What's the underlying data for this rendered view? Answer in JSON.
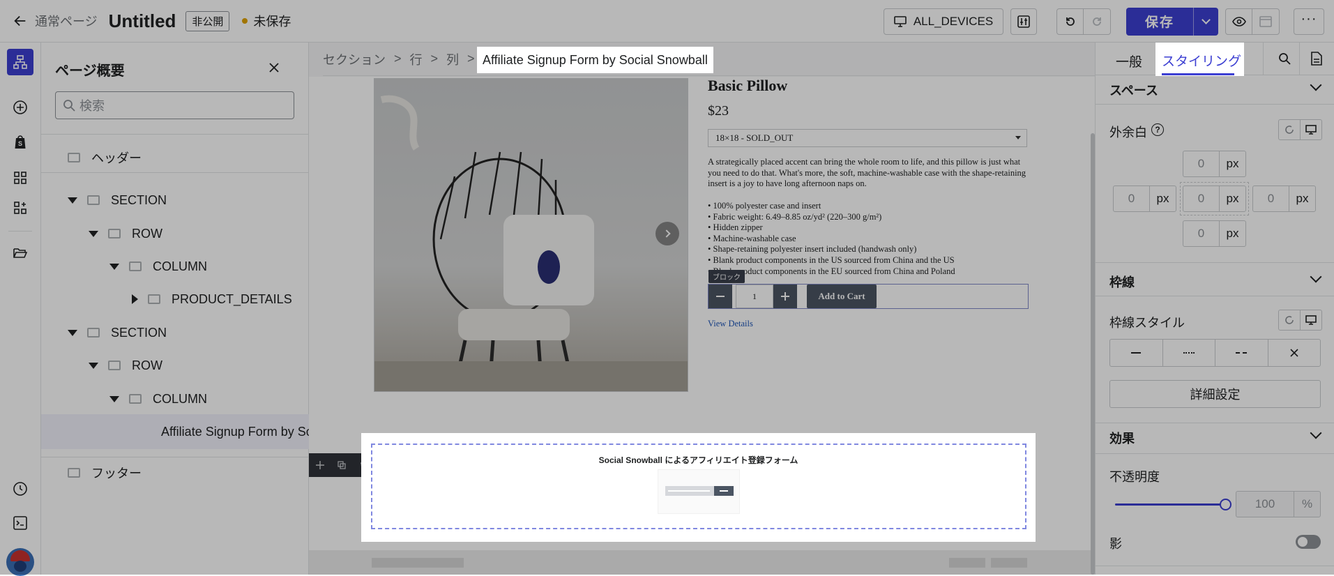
{
  "topbar": {
    "back_label": "通常ページ",
    "title": "Untitled",
    "visibility_badge": "非公開",
    "status": "未保存",
    "device_label": "ALL_DEVICES",
    "save_label": "保存"
  },
  "outline": {
    "title": "ページ概要",
    "search_placeholder": "検索",
    "items": [
      {
        "label": "ヘッダー"
      },
      {
        "label": "SECTION"
      },
      {
        "label": "ROW"
      },
      {
        "label": "COLUMN"
      },
      {
        "label": "PRODUCT_DETAILS"
      },
      {
        "label": "SECTION"
      },
      {
        "label": "ROW"
      },
      {
        "label": "COLUMN"
      },
      {
        "label": "Affiliate Signup Form by Social Snowball"
      },
      {
        "label": "フッター"
      }
    ]
  },
  "breadcrumb": {
    "items": [
      "セクション",
      "行",
      "列"
    ],
    "current": "Affiliate Signup Form by Social Snowball"
  },
  "product": {
    "title": "Basic Pillow",
    "price": "$23",
    "variant": "18×18 - SOLD_OUT",
    "description": "A strategically placed accent can bring the whole room to life, and this pillow is just what you need to do that. What's more, the soft, machine-washable case with the shape-retaining insert is a joy to have long afternoon naps on.",
    "features": [
      "• 100% polyester case and insert",
      "• Fabric weight: 6.49–8.85 oz/yd² (220–300 g/m²)",
      "• Hidden zipper",
      "• Machine-washable case",
      "• Shape-retaining polyester insert included (handwash only)",
      "• Blank product components in the US sourced from China and the US",
      "• Blank product components in the EU sourced from China and Poland"
    ],
    "block_tag": "ブロック",
    "quantity": "1",
    "add_to_cart": "Add to Cart",
    "view_details": "View Details"
  },
  "affiliate": {
    "title": "Social Snowball によるアフィリエイト登録フォーム"
  },
  "rpanel": {
    "tabs": [
      "一般",
      "スタイリング"
    ],
    "spacing_title": "スペース",
    "margin_label": "外余白",
    "zero": "0",
    "unit": "px",
    "border_title": "枠線",
    "border_style_label": "枠線スタイル",
    "advanced_label": "詳細設定",
    "effects_title": "効果",
    "opacity_label": "不透明度",
    "opacity_value": "100",
    "percent": "%",
    "opacity_level": 1.0,
    "shadow_label": "影"
  },
  "colors": {
    "accent": "#3c3fd2",
    "dark": "#4b5563"
  }
}
